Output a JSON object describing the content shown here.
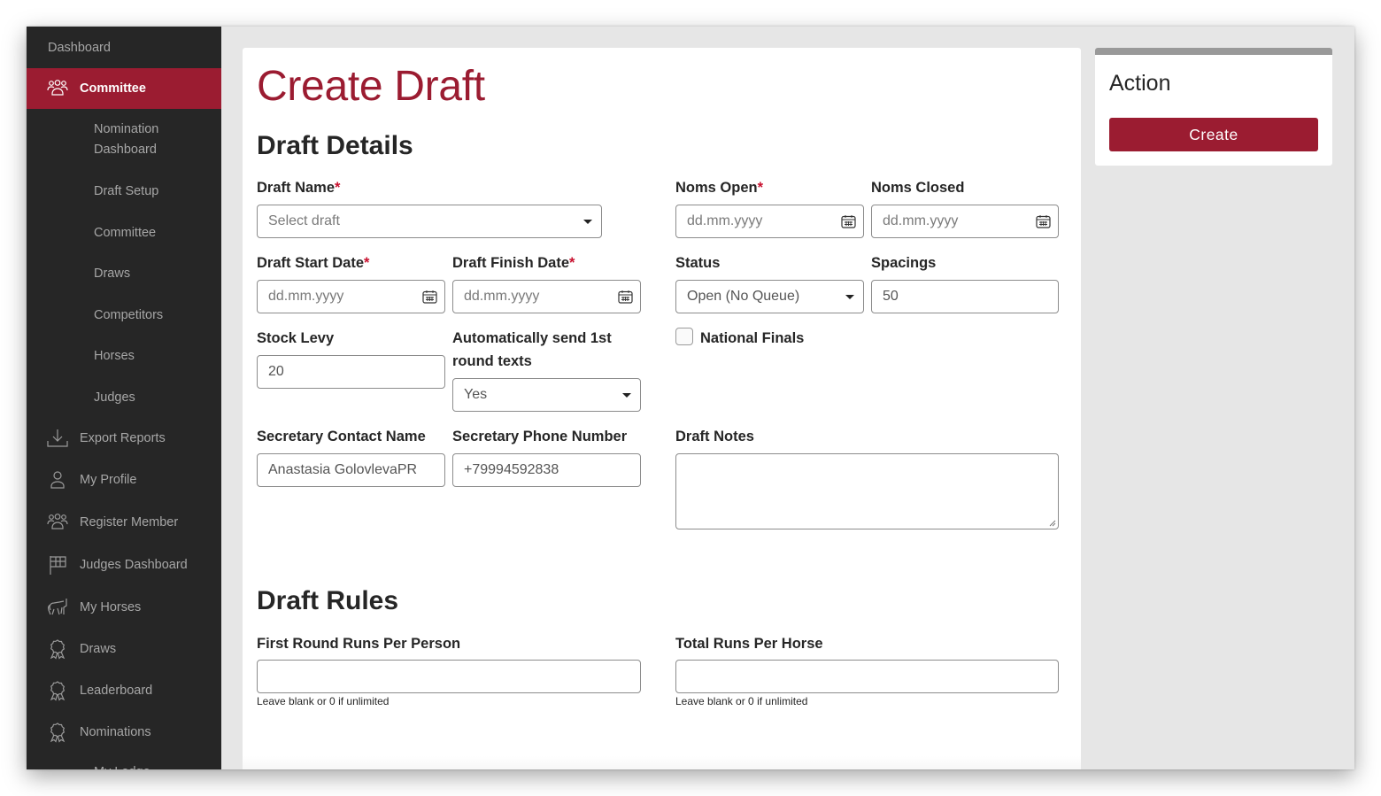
{
  "sidebar": {
    "items": [
      {
        "label": "Dashboard",
        "icon": "none"
      },
      {
        "label": "Committee",
        "icon": "users-icon",
        "active": true
      },
      {
        "label": "Nomination Dashboard"
      },
      {
        "label": "Draft Setup"
      },
      {
        "label": "Committee"
      },
      {
        "label": "Draws"
      },
      {
        "label": "Competitors"
      },
      {
        "label": "Horses"
      },
      {
        "label": "Judges"
      },
      {
        "label": "Export Reports",
        "icon": "download-icon"
      },
      {
        "label": "My Profile",
        "icon": "user-icon"
      },
      {
        "label": "Register Member",
        "icon": "users-icon"
      },
      {
        "label": "Judges Dashboard",
        "icon": "checkered-flag-icon"
      },
      {
        "label": "My Horses",
        "icon": "horse-icon"
      },
      {
        "label": "Draws",
        "icon": "award-ribbon-icon"
      },
      {
        "label": "Leaderboard",
        "icon": "award-ribbon-icon"
      },
      {
        "label": "Nominations",
        "icon": "award-ribbon-icon"
      },
      {
        "label": "My Lodge",
        "icon": "none"
      }
    ],
    "colors": {
      "background": "#262626",
      "active": "#9b1c31"
    }
  },
  "page": {
    "title": "Create Draft",
    "sections": {
      "details": "Draft Details",
      "rules": "Draft Rules"
    },
    "required_mark": "*",
    "fields": {
      "draft_name": {
        "label": "Draft Name",
        "required": true,
        "placeholder": "Select draft",
        "value": ""
      },
      "noms_open": {
        "label": "Noms Open",
        "required": true,
        "placeholder": "dd.mm.yyyy"
      },
      "noms_closed": {
        "label": "Noms Closed",
        "required": false,
        "placeholder": "dd.mm.yyyy"
      },
      "start_date": {
        "label": "Draft Start Date",
        "required": true,
        "placeholder": "dd.mm.yyyy"
      },
      "finish_date": {
        "label": "Draft Finish Date",
        "required": true,
        "placeholder": "dd.mm.yyyy"
      },
      "status": {
        "label": "Status",
        "value": "Open (No Queue)"
      },
      "spacings": {
        "label": "Spacings",
        "value": "50"
      },
      "stock_levy": {
        "label": "Stock Levy",
        "value": "20"
      },
      "auto_send": {
        "label": "Automatically send 1st round texts",
        "label_line1": "Automatically send 1st",
        "label_line2": "round texts",
        "value": "Yes"
      },
      "national_finals": {
        "label": "National Finals",
        "checked": false
      },
      "secretary_name": {
        "label": "Secretary Contact Name",
        "value": "Anastasia GolovlevaPR"
      },
      "secretary_phone": {
        "label": "Secretary Phone Number",
        "value": "+79994592838"
      },
      "draft_notes": {
        "label": "Draft Notes",
        "value": ""
      },
      "first_round_runs": {
        "label": "First Round Runs Per Person",
        "value": "",
        "help": "Leave blank or 0 if unlimited"
      },
      "total_runs_horse": {
        "label": "Total Runs Per Horse",
        "value": "",
        "help": "Leave blank or 0 if unlimited"
      }
    },
    "colors": {
      "title": "#9b1c31",
      "required": "#c8102e"
    }
  },
  "action": {
    "title": "Action",
    "create_label": "Create",
    "colors": {
      "button": "#9b1c31",
      "header_bar": "#999999"
    }
  }
}
